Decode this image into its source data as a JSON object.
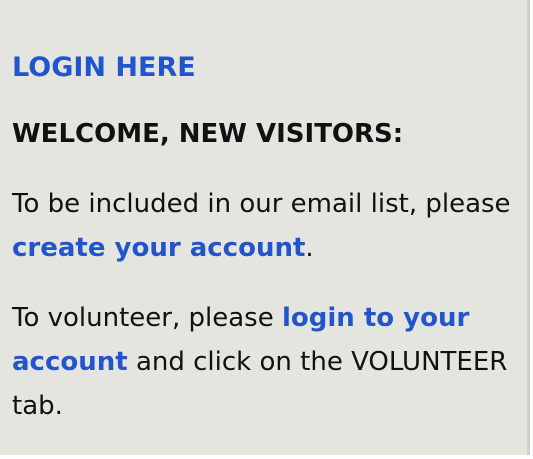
{
  "links": {
    "login_here": "LOGIN HERE",
    "create_account": "create your account",
    "login_account": "login to your account"
  },
  "welcome": {
    "heading": "WELCOME, NEW VISITORS:"
  },
  "email_paragraph": {
    "before": "To be included in our email list, please ",
    "after": "."
  },
  "volunteer_paragraph": {
    "before": "To volunteer, please ",
    "after": " and click on the VOLUNTEER tab."
  },
  "colors": {
    "link": "#2255cc",
    "panel_background": "#e5e5df",
    "text": "#111111"
  }
}
